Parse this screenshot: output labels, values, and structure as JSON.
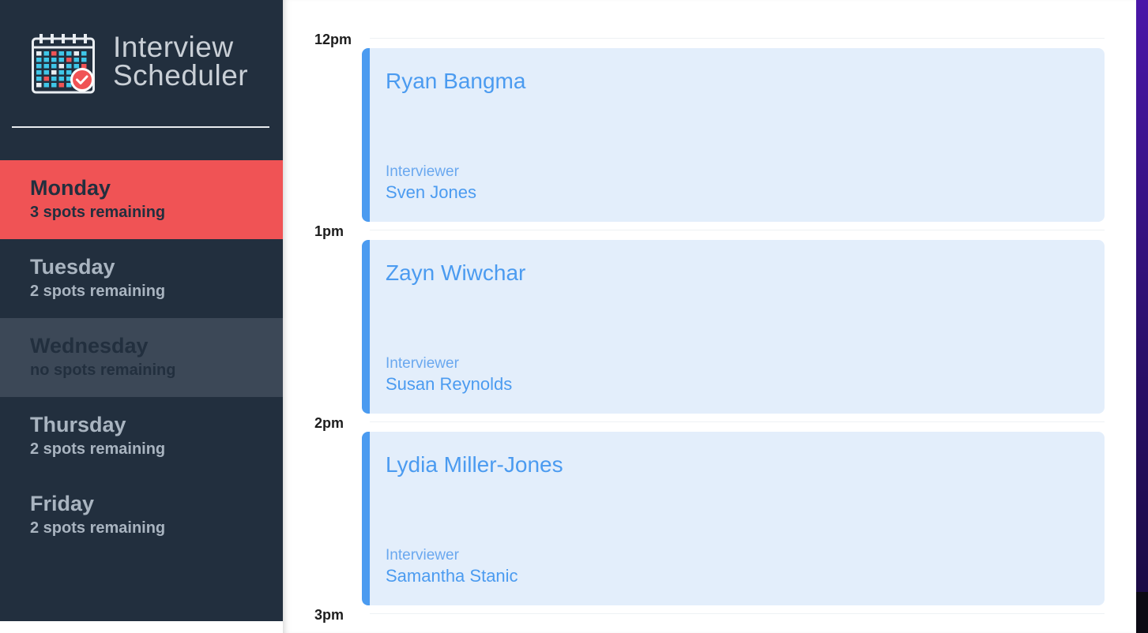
{
  "brand": {
    "title": "Interview\nScheduler",
    "icon": "calendar-check-icon"
  },
  "days": [
    {
      "name": "Monday",
      "spots": "3 spots remaining",
      "state": "selected"
    },
    {
      "name": "Tuesday",
      "spots": "2 spots remaining",
      "state": "normal"
    },
    {
      "name": "Wednesday",
      "spots": "no spots remaining",
      "state": "full"
    },
    {
      "name": "Thursday",
      "spots": "2 spots remaining",
      "state": "normal"
    },
    {
      "name": "Friday",
      "spots": "2 spots remaining",
      "state": "normal"
    }
  ],
  "appointments": [
    {
      "time": "12pm",
      "student": "Ryan Bangma",
      "interviewer_label": "Interviewer",
      "interviewer": "Sven Jones"
    },
    {
      "time": "1pm",
      "student": "Zayn Wiwchar",
      "interviewer_label": "Interviewer",
      "interviewer": "Susan Reynolds"
    },
    {
      "time": "2pm",
      "student": "Lydia Miller-Jones",
      "interviewer_label": "Interviewer",
      "interviewer": "Samantha Stanic"
    }
  ],
  "last_time": "3pm",
  "colors": {
    "sidebar_bg": "#222f3e",
    "selected_day": "#f05355",
    "full_day": "#3c4857",
    "card_bg": "#e3eefb",
    "accent_blue": "#4b9bf0"
  }
}
